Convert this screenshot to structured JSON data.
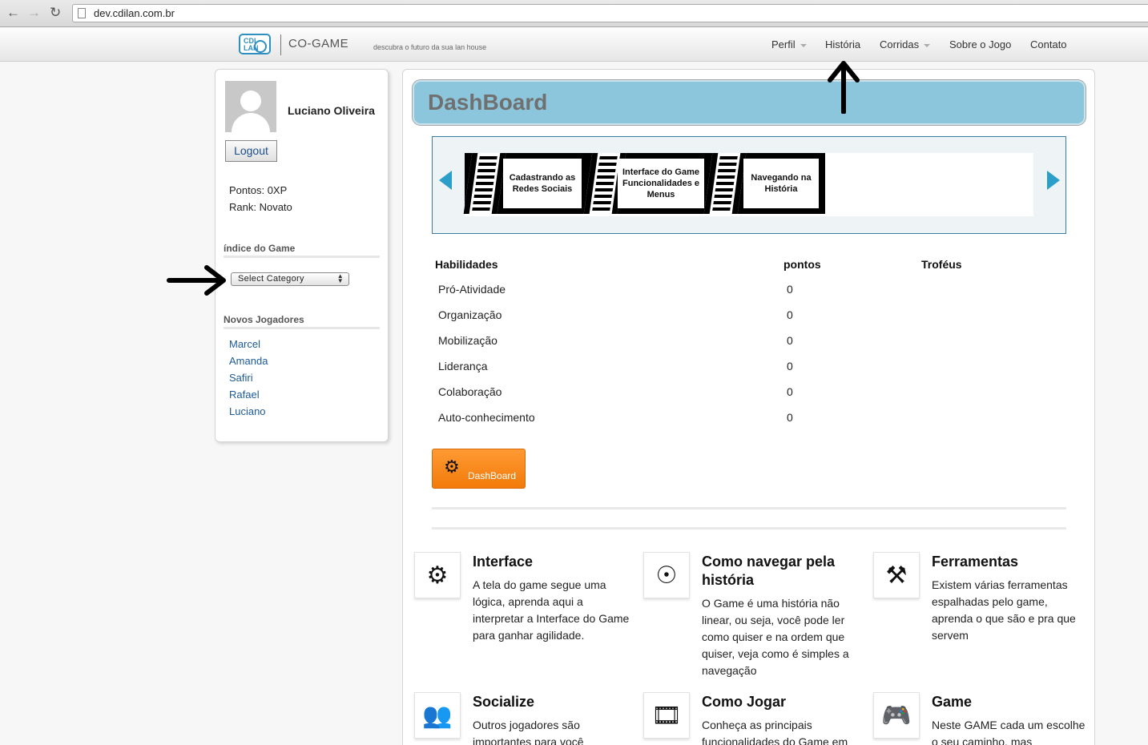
{
  "browser": {
    "url": "dev.cdilan.com.br"
  },
  "header": {
    "logo_text": "CDI LAN",
    "brand": "CO-GAME",
    "tagline": "descubra o futuro da sua lan house",
    "menu": [
      {
        "label": "Perfil"
      },
      {
        "label": "História"
      },
      {
        "label": "Corridas"
      },
      {
        "label": "Sobre o Jogo"
      },
      {
        "label": "Contato"
      }
    ]
  },
  "sidebar": {
    "username": "Luciano Oliveira",
    "logout": "Logout",
    "points": "Pontos: 0XP",
    "rank": "Rank: Novato",
    "index_title": "índice do Game",
    "select_value": "Select Category",
    "new_players_title": "Novos Jogadores",
    "players": [
      "Marcel",
      "Amanda",
      "Safiri",
      "Rafael",
      "Luciano"
    ]
  },
  "main": {
    "title": "DashBoard",
    "slides": [
      "Cadastrando as Redes Sociais",
      "Interface do Game Funcionalidades e Menus",
      "Navegando na História"
    ],
    "table": {
      "headers": [
        "Habilidades",
        "pontos",
        "Troféus"
      ],
      "rows": [
        {
          "skill": "Pró-Atividade",
          "points": "0"
        },
        {
          "skill": "Organização",
          "points": "0"
        },
        {
          "skill": "Mobilização",
          "points": "0"
        },
        {
          "skill": "Liderança",
          "points": "0"
        },
        {
          "skill": "Colaboração",
          "points": "0"
        },
        {
          "skill": "Auto-conhecimento",
          "points": "0"
        }
      ]
    },
    "dashboard_button": "DashBoard",
    "features": [
      {
        "icon": "gear-icon",
        "title": "Interface",
        "text": "A tela do game segue uma lógica, aprenda aqui a interpretar a Interface do Game para ganhar agilidade."
      },
      {
        "icon": "compass-icon",
        "title": "Como navegar pela história",
        "text": "O Game é uma história não linear, ou seja, você pode ler como quiser e na ordem que quiser, veja como é simples a navegação"
      },
      {
        "icon": "tools-icon",
        "title": "Ferramentas",
        "text": "Existem várias ferramentas espalhadas pelo game, aprenda o que são e pra que servem"
      },
      {
        "icon": "users-icon",
        "title": "Socialize",
        "text": "Outros jogadores são importantes para você"
      },
      {
        "icon": "film-icon",
        "title": "Como Jogar",
        "text": "Conheça as principais funcionalidades do Game em"
      },
      {
        "icon": "gamepad-icon",
        "title": "Game",
        "text": "Neste GAME cada um escolhe o seu caminho, mas"
      }
    ]
  }
}
